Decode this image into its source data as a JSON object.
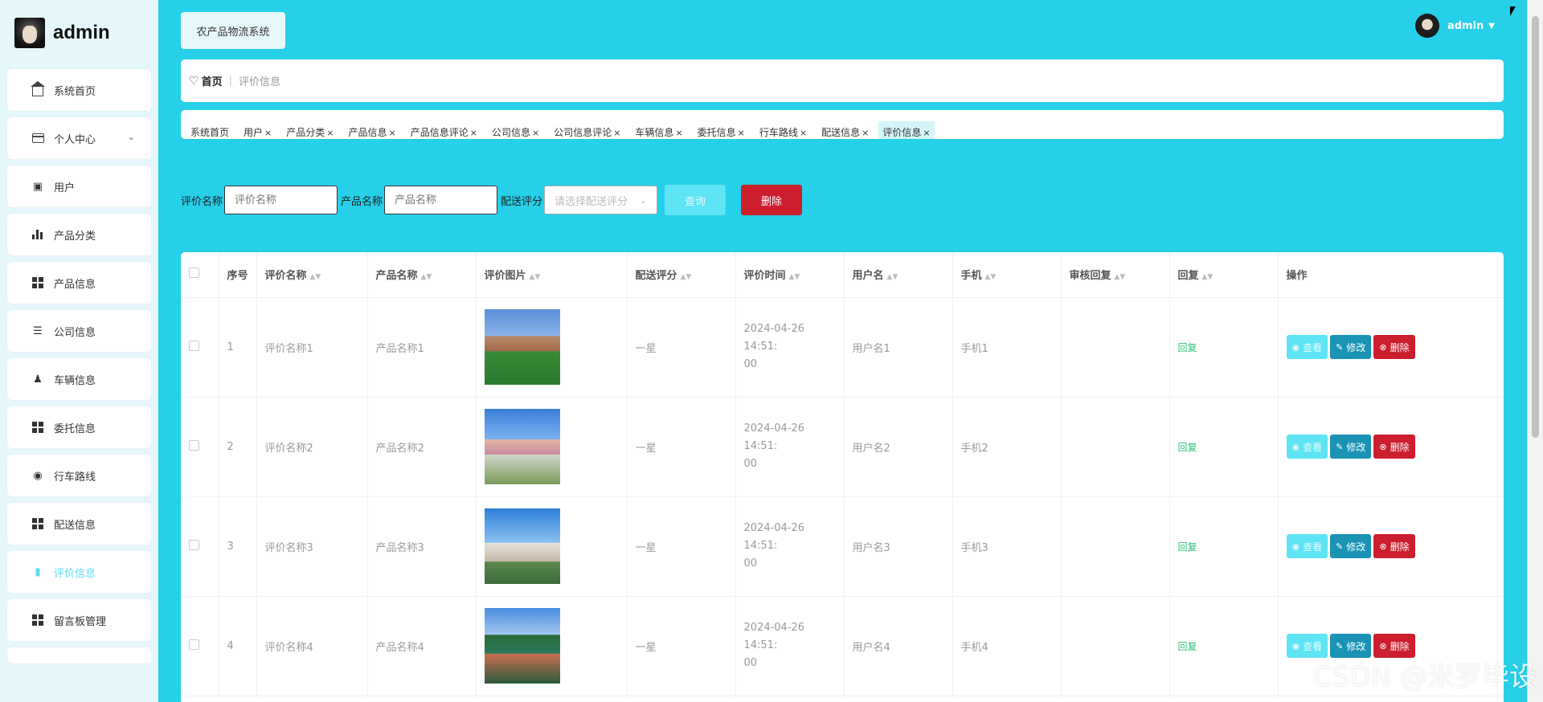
{
  "brand": {
    "name": "admin"
  },
  "sidebar": {
    "items": [
      {
        "label": "系统首页",
        "icon": "home-icon"
      },
      {
        "label": "个人中心",
        "icon": "id-card-icon",
        "expandable": true
      },
      {
        "label": "用户",
        "icon": "user-icon"
      },
      {
        "label": "产品分类",
        "icon": "bar-chart-icon"
      },
      {
        "label": "产品信息",
        "icon": "grid-icon"
      },
      {
        "label": "公司信息",
        "icon": "sliders-icon"
      },
      {
        "label": "车辆信息",
        "icon": "person-icon"
      },
      {
        "label": "委托信息",
        "icon": "grid-icon"
      },
      {
        "label": "行车路线",
        "icon": "location-pin-icon"
      },
      {
        "label": "配送信息",
        "icon": "grid-icon"
      },
      {
        "label": "评价信息",
        "icon": "comment-icon",
        "active": true
      },
      {
        "label": "留言板管理",
        "icon": "grid-icon"
      }
    ]
  },
  "header": {
    "system_title": "农产品物流系统",
    "user_name": "admin"
  },
  "breadcrumb": {
    "home": "首页",
    "current": "评价信息"
  },
  "tags": [
    {
      "label": "系统首页"
    },
    {
      "label": "用户"
    },
    {
      "label": "产品分类"
    },
    {
      "label": "产品信息"
    },
    {
      "label": "产品信息评论"
    },
    {
      "label": "公司信息"
    },
    {
      "label": "公司信息评论"
    },
    {
      "label": "车辆信息"
    },
    {
      "label": "委托信息"
    },
    {
      "label": "行车路线"
    },
    {
      "label": "配送信息"
    },
    {
      "label": "评价信息",
      "active": true
    }
  ],
  "search": {
    "label_name": "评价名称",
    "placeholder_name": "评价名称",
    "label_product": "产品名称",
    "placeholder_product": "产品名称",
    "label_rating": "配送评分",
    "placeholder_rating": "请选择配送评分",
    "query_button": "查询",
    "delete_button": "删除"
  },
  "table": {
    "columns": {
      "index": "序号",
      "name": "评价名称",
      "product": "产品名称",
      "image": "评价图片",
      "rating": "配送评分",
      "time": "评价时间",
      "user": "用户名",
      "phone": "手机",
      "audit_reply": "审核回复",
      "reply": "回复",
      "ops": "操作"
    },
    "rows": [
      {
        "index": "1",
        "name": "评价名称1",
        "product": "产品名称1",
        "rating": "一星",
        "time1": "2024-04-26 14:51:",
        "time2": "00",
        "user": "用户名1",
        "phone": "手机1",
        "audit_reply": "",
        "reply": "回复"
      },
      {
        "index": "2",
        "name": "评价名称2",
        "product": "产品名称2",
        "rating": "一星",
        "time1": "2024-04-26 14:51:",
        "time2": "00",
        "user": "用户名2",
        "phone": "手机2",
        "audit_reply": "",
        "reply": "回复"
      },
      {
        "index": "3",
        "name": "评价名称3",
        "product": "产品名称3",
        "rating": "一星",
        "time1": "2024-04-26 14:51:",
        "time2": "00",
        "user": "用户名3",
        "phone": "手机3",
        "audit_reply": "",
        "reply": "回复"
      },
      {
        "index": "4",
        "name": "评价名称4",
        "product": "产品名称4",
        "rating": "一星",
        "time1": "2024-04-26 14:51:",
        "time2": "00",
        "user": "用户名4",
        "phone": "手机4",
        "audit_reply": "",
        "reply": "回复"
      }
    ],
    "ops": {
      "view": "查看",
      "edit": "修改",
      "delete": "删除"
    }
  },
  "watermark": "CSDN @米罗毕设",
  "colors": {
    "main_bg": "#25d0e8",
    "sidebar_bg": "#e6f7fb",
    "accent_light": "#5ee4f4",
    "edit_blue": "#1a93b4",
    "danger_red": "#cc1e2d",
    "reply_green": "#2fbf7a"
  }
}
